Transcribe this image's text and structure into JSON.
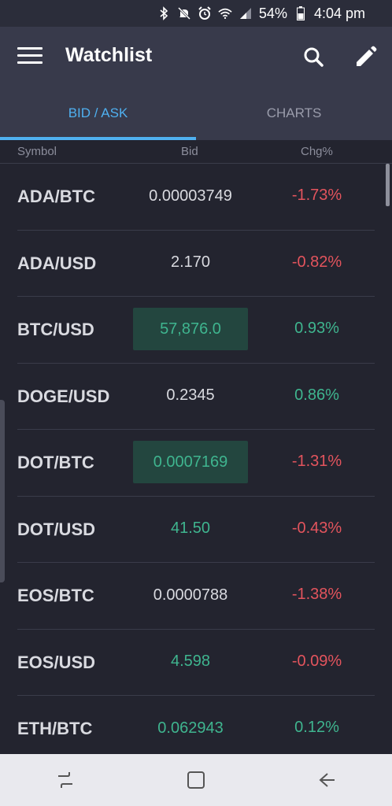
{
  "status_bar": {
    "battery": "54%",
    "time": "4:04 pm"
  },
  "app_bar": {
    "title": "Watchlist"
  },
  "tabs": [
    {
      "label": "BID / ASK",
      "active": true
    },
    {
      "label": "CHARTS",
      "active": false
    }
  ],
  "columns": {
    "symbol": "Symbol",
    "bid": "Bid",
    "chg": "Chg%"
  },
  "rows": [
    {
      "symbol": "ADA/BTC",
      "bid": "0.00003749",
      "chg": "-1.73%",
      "bid_color": "neutral",
      "chg_color": "down",
      "highlight": false
    },
    {
      "symbol": "ADA/USD",
      "bid": "2.170",
      "chg": "-0.82%",
      "bid_color": "neutral",
      "chg_color": "down",
      "highlight": false
    },
    {
      "symbol": "BTC/USD",
      "bid": "57,876.0",
      "chg": "0.93%",
      "bid_color": "up",
      "chg_color": "up",
      "highlight": true
    },
    {
      "symbol": "DOGE/USD",
      "bid": "0.2345",
      "chg": "0.86%",
      "bid_color": "neutral",
      "chg_color": "up",
      "highlight": false
    },
    {
      "symbol": "DOT/BTC",
      "bid": "0.0007169",
      "chg": "-1.31%",
      "bid_color": "up",
      "chg_color": "down",
      "highlight": true
    },
    {
      "symbol": "DOT/USD",
      "bid": "41.50",
      "chg": "-0.43%",
      "bid_color": "up",
      "chg_color": "down",
      "highlight": false
    },
    {
      "symbol": "EOS/BTC",
      "bid": "0.0000788",
      "chg": "-1.38%",
      "bid_color": "neutral",
      "chg_color": "down",
      "highlight": false
    },
    {
      "symbol": "EOS/USD",
      "bid": "4.598",
      "chg": "-0.09%",
      "bid_color": "up",
      "chg_color": "down",
      "highlight": false
    },
    {
      "symbol": "ETH/BTC",
      "bid": "0.062943",
      "chg": "0.12%",
      "bid_color": "up",
      "chg_color": "up",
      "highlight": false
    }
  ],
  "colors": {
    "accent": "#4fb0f0",
    "up": "#3fb58f",
    "down": "#e3545d",
    "highlight_bg": "#23463f",
    "background": "#23242f",
    "toolbar": "#383a4b"
  },
  "icons": {
    "menu": "hamburger-icon",
    "search": "search-icon",
    "edit": "pencil-icon",
    "nav_recent": "recent-apps-icon",
    "nav_home": "home-icon",
    "nav_back": "back-icon"
  }
}
